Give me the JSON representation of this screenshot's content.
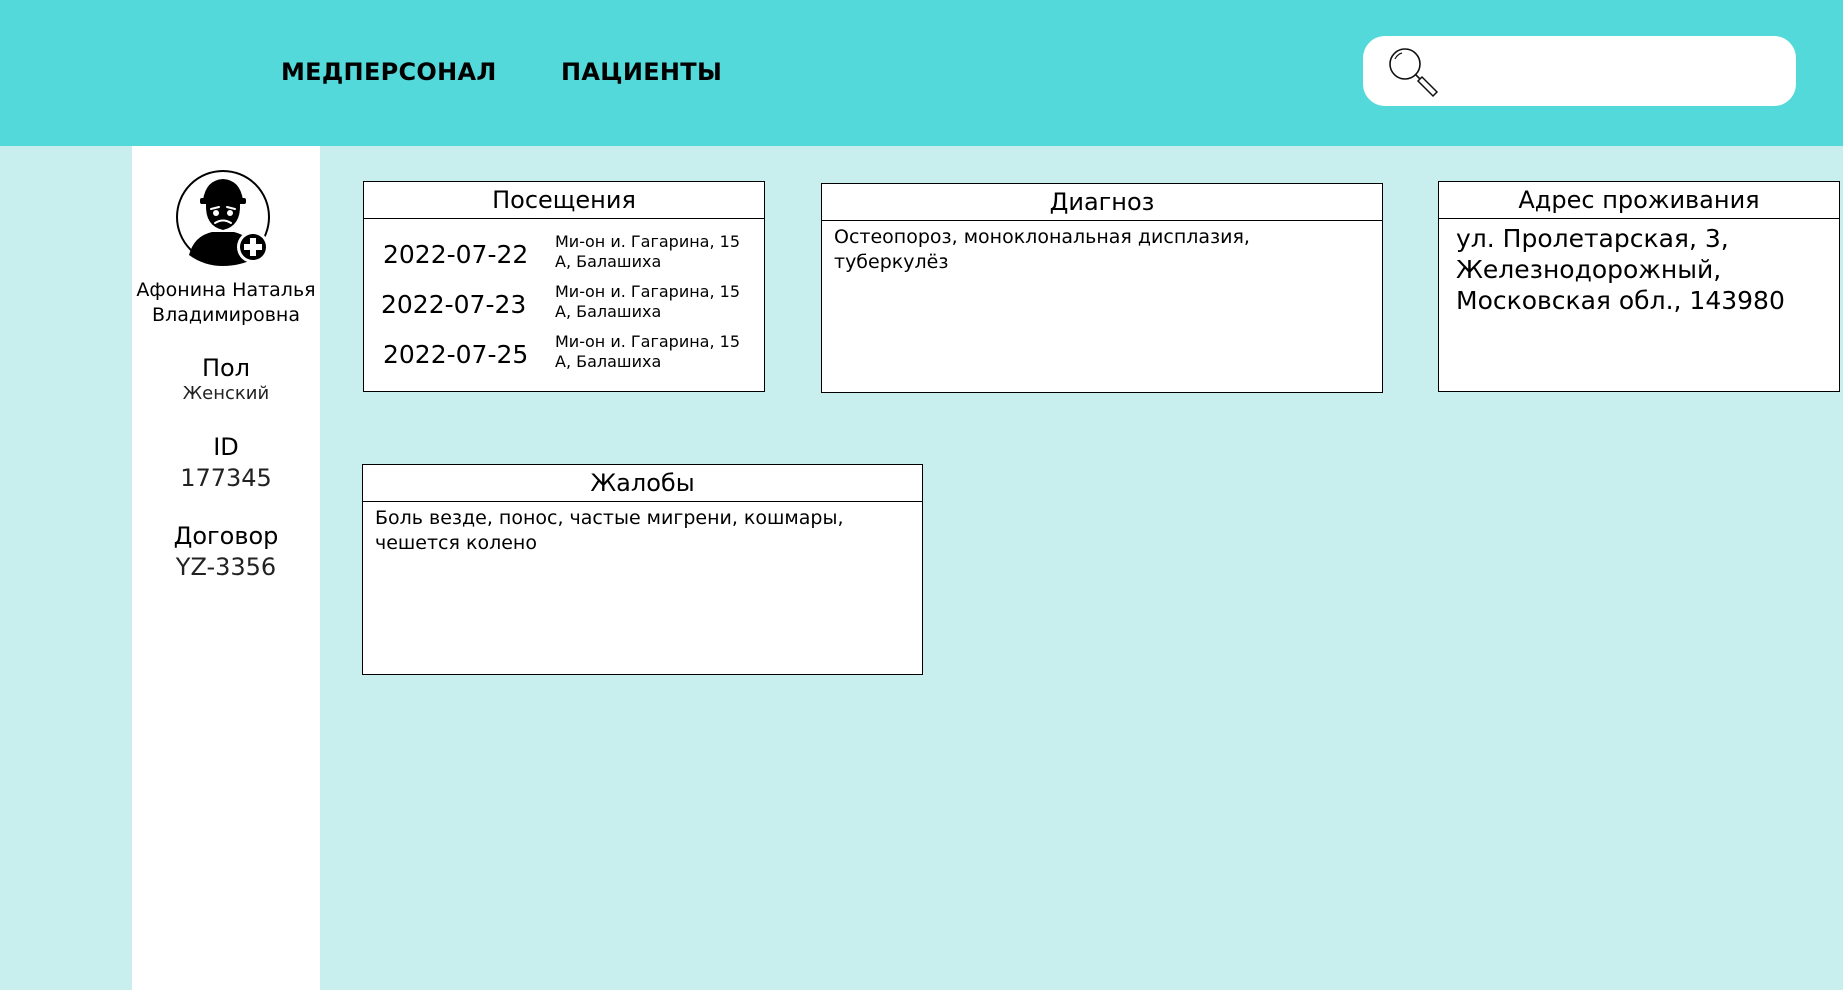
{
  "nav": {
    "staff_label": "МЕДПЕРСОНАЛ",
    "patients_label": "ПАЦИЕНТЫ"
  },
  "search": {
    "icon": "search-icon",
    "value": "",
    "placeholder": ""
  },
  "patient": {
    "avatar_icon": "doctor-avatar-icon",
    "name": "Афонина Наталья Владимировна",
    "gender_label": "Пол",
    "gender_value": "Женский",
    "id_label": "ID",
    "id_value": "177345",
    "contract_label": "Договор",
    "contract_value": "YZ-3356"
  },
  "visits": {
    "title": "Посещения",
    "items": [
      {
        "date": "2022-07-22",
        "place": "Ми-он и. Гагарина, 15 А, Балашиха"
      },
      {
        "date": "2022-07-23",
        "place": "Ми-он и. Гагарина, 15 А, Балашиха"
      },
      {
        "date": "2022-07-25",
        "place": "Ми-он и. Гагарина, 15 А, Балашиха"
      }
    ]
  },
  "diagnosis": {
    "title": "Диагноз",
    "text": "Остеопороз, моноклональная дисплазия, туберкулёз"
  },
  "address": {
    "title": "Адрес проживания",
    "text": "ул. Пролетарская, 3, Железнодорожный, Московская обл., 143980"
  },
  "complaints": {
    "title": "Жалобы",
    "text": "Боль везде, понос, частые мигрени, кошмары, чешется колено"
  },
  "colors": {
    "header_bg": "#53d9d9",
    "page_bg": "#c8efed",
    "card_bg": "#ffffff",
    "border": "#000000"
  }
}
